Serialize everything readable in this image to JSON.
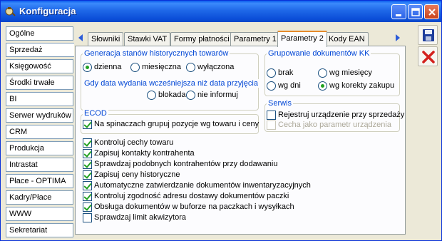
{
  "window": {
    "title": "Konfiguracja"
  },
  "sidebar": {
    "items": [
      {
        "label": "Ogólne"
      },
      {
        "label": "Sprzedaż"
      },
      {
        "label": "Księgowość"
      },
      {
        "label": "Środki trwałe"
      },
      {
        "label": "BI"
      },
      {
        "label": "Serwer wydruków"
      },
      {
        "label": "CRM"
      },
      {
        "label": "Produkcja"
      },
      {
        "label": "Intrastat"
      },
      {
        "label": "Płace - OPTIMA"
      },
      {
        "label": "Kadry/Płace"
      },
      {
        "label": "WWW"
      },
      {
        "label": "Sekretariat"
      }
    ],
    "active": "Sprzedaż"
  },
  "tabs": [
    {
      "label": "Słowniki"
    },
    {
      "label": "Stawki VAT"
    },
    {
      "label": "Formy płatności"
    },
    {
      "label": "Parametry 1"
    },
    {
      "label": "Parametry 2"
    },
    {
      "label": "Kody EAN"
    }
  ],
  "active_tab": "Parametry 2",
  "panel": {
    "gen": {
      "label": "Generacja stanów historycznych towarów",
      "options": [
        {
          "label": "dzienna",
          "checked": true
        },
        {
          "label": "miesięczna",
          "checked": false
        },
        {
          "label": "wyłączona",
          "checked": false
        }
      ]
    },
    "date": {
      "label": "Gdy data wydania wcześniejsza niż data przyjęcia",
      "options": [
        {
          "label": "blokada",
          "checked": false
        },
        {
          "label": "nie informuj",
          "checked": false
        }
      ]
    },
    "group": {
      "label": "Grupowanie dokumentów KK",
      "options": [
        {
          "label": "brak",
          "checked": false
        },
        {
          "label": "wg miesięcy",
          "checked": false
        },
        {
          "label": "wg dni",
          "checked": false
        },
        {
          "label": "wg korekty zakupu",
          "checked": true
        }
      ]
    },
    "ecod": {
      "label": "ECOD",
      "option": {
        "label": "Na spinaczach grupuj pozycje wg towaru i ceny",
        "checked": true
      }
    },
    "serwis": {
      "label": "Serwis",
      "options": [
        {
          "label": "Rejestruj urządzenie przy sprzedaży",
          "checked": false,
          "enabled": true
        },
        {
          "label": "Cecha jako parametr urządzenia",
          "checked": false,
          "enabled": false
        }
      ]
    },
    "checks": [
      {
        "label": "Kontroluj cechy towaru",
        "checked": true
      },
      {
        "label": "Zapisuj kontakty kontrahenta",
        "checked": true
      },
      {
        "label": "Sprawdzaj podobnych kontrahentów przy dodawaniu",
        "checked": true
      },
      {
        "label": "Zapisuj ceny historyczne",
        "checked": true
      },
      {
        "label": "Automatyczne zatwierdzanie dokumentów inwentaryzacyjnych",
        "checked": true
      },
      {
        "label": "Kontroluj zgodność adresu dostawy dokumentów paczki",
        "checked": true
      },
      {
        "label": "Obsługa dokumentów w buforze na paczkach i wysyłkach",
        "checked": true
      },
      {
        "label": "Sprawdzaj limit akwizytora",
        "checked": false
      }
    ]
  },
  "tools": {
    "save": "save-icon",
    "close": "close-x-icon"
  },
  "colors": {
    "title": "#0A5CEC",
    "accent_tab": "#E68B2C",
    "group_label": "#0046D5",
    "check": "#21A121",
    "close": "#D3201C"
  }
}
